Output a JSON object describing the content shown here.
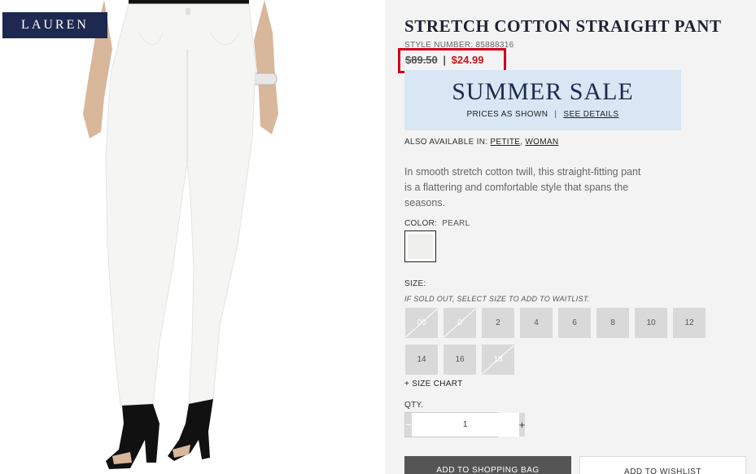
{
  "brand": {
    "logo_text": "LAUREN"
  },
  "product": {
    "title": "STRETCH COTTON STRAIGHT PANT",
    "style_number": "STYLE NUMBER: 85888316",
    "original_price": "$89.50",
    "price_separator": "|",
    "sale_price": "$24.99",
    "description": "In smooth stretch cotton twill, this straight-fitting pant is a flattering and comfortable style that spans the seasons."
  },
  "sale_banner": {
    "title": "SUMMER SALE",
    "prices_text": "PRICES AS SHOWN",
    "separator": "|",
    "details_link": "SEE DETAILS",
    "background": "#d8e7f3"
  },
  "also_available": {
    "label": "ALSO AVAILABLE IN:",
    "links": [
      "PETITE",
      "WOMAN"
    ],
    "separator": ","
  },
  "color": {
    "label": "COLOR:",
    "value": "PEARL"
  },
  "size": {
    "label": "SIZE:",
    "note": "IF SOLD OUT, SELECT SIZE TO ADD TO WAITLIST.",
    "options": [
      {
        "label": "00",
        "sold_out": true
      },
      {
        "label": "0",
        "sold_out": true
      },
      {
        "label": "2",
        "sold_out": false
      },
      {
        "label": "4",
        "sold_out": false
      },
      {
        "label": "6",
        "sold_out": false
      },
      {
        "label": "8",
        "sold_out": false
      },
      {
        "label": "10",
        "sold_out": false
      },
      {
        "label": "12",
        "sold_out": false
      },
      {
        "label": "14",
        "sold_out": false
      },
      {
        "label": "16",
        "sold_out": false
      },
      {
        "label": "18",
        "sold_out": true
      }
    ],
    "chart_link": "+ SIZE CHART"
  },
  "quantity": {
    "label": "QTY.",
    "minus": "−",
    "value": "1",
    "plus": "+"
  },
  "actions": {
    "add_to_bag": "ADD TO SHOPPING BAG",
    "add_to_wishlist": "ADD TO WISHLIST"
  },
  "colors": {
    "price_highlight": "#d0021b",
    "sale_price": "#c4161c",
    "brand": "#1d2950"
  }
}
